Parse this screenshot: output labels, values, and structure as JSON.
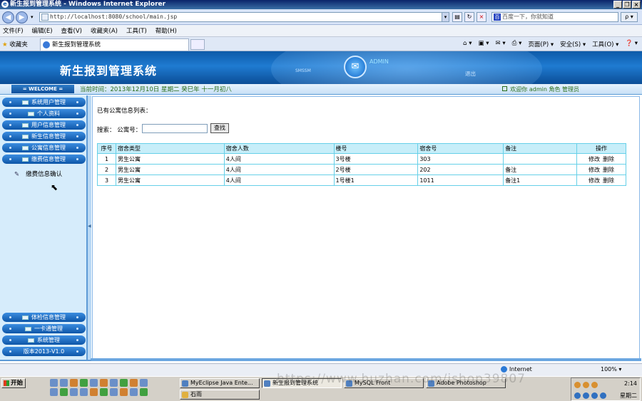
{
  "window": {
    "title": "新生报到管理系统 - Windows Internet Explorer",
    "buttons": [
      "_",
      "❐",
      "×"
    ]
  },
  "browser": {
    "back_icon": "arrow-left-icon",
    "forward_icon": "arrow-right-icon",
    "address": "http://localhost:8080/school/main.jsp",
    "search_placeholder": "百度一下，你就知道",
    "search_btn": "ρ ▾",
    "menu": [
      "文件(F)",
      "编辑(E)",
      "查看(V)",
      "收藏夹(A)",
      "工具(T)",
      "帮助(H)"
    ],
    "favorites_label": "收藏夹",
    "tab_title": "新生报到管理系统",
    "commands": [
      "页面(P) ▾",
      "安全(S) ▾",
      "工具(O) ▾",
      "❓ ▾"
    ],
    "status_zone": "Internet",
    "zoom": "100% ▾"
  },
  "app": {
    "title": "新生报到管理系统",
    "header_small": "SMSSM",
    "header_link": "ADMIN",
    "logout": "退出",
    "welcome": "= WELCOME =",
    "current_time": "当前时间：2013年12月10日 星期二 癸巳年 十一月初八",
    "user_info": "欢迎你 admin 角色 管理员"
  },
  "sidebar": {
    "top_items": [
      {
        "label": "系统用户管理"
      },
      {
        "label": "个人资料"
      },
      {
        "label": "用户信息管理"
      },
      {
        "label": "新生信息管理"
      },
      {
        "label": "公寓信息管理"
      },
      {
        "label": "缴费信息管理"
      }
    ],
    "sub_item": "缴费信息确认",
    "bottom_items": [
      {
        "label": "体检信息管理"
      },
      {
        "label": "一卡通管理"
      },
      {
        "label": "系统管理"
      },
      {
        "label": "版本2013-V1.0"
      }
    ]
  },
  "main": {
    "list_title": "已有公寓信息列表：",
    "search_label": "搜索：  公寓号：",
    "search_value": "",
    "search_button": "查找",
    "columns": [
      "序号",
      "宿舍类型",
      "宿舍人数",
      "楼号",
      "宿舍号",
      "备注",
      "操作"
    ],
    "rows": [
      {
        "no": "1",
        "type": "男生公寓",
        "people": "4人间",
        "building": "3号楼",
        "room": "303",
        "note": "",
        "edit": "修改",
        "del": "删除"
      },
      {
        "no": "2",
        "type": "男生公寓",
        "people": "4人间",
        "building": "2号楼",
        "room": "202",
        "note": "备注",
        "edit": "修改",
        "del": "删除"
      },
      {
        "no": "3",
        "type": "男生公寓",
        "people": "4人间",
        "building": "1号楼1",
        "room": "1011",
        "note": "备注1",
        "edit": "修改",
        "del": "删除"
      }
    ]
  },
  "taskbar": {
    "start": "开始",
    "tasks": [
      {
        "label": "MyEclipse Java Ente..."
      },
      {
        "label": "新生报到管理系统"
      },
      {
        "label": "MySQL Front"
      },
      {
        "label": "Adobe Photoshop"
      }
    ],
    "task_row2": "石雨",
    "clock": "2:14",
    "day": "星期二"
  },
  "watermark": "https://www.huzhan.com/ishop39807"
}
